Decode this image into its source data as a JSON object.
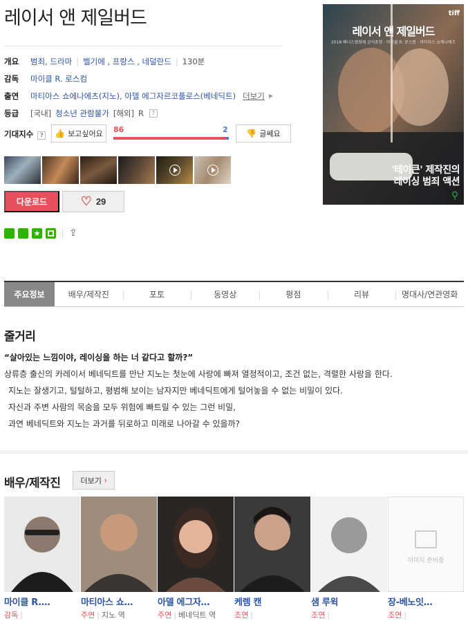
{
  "movie": {
    "title": "레이서 앤 제일버드",
    "info": {
      "overview_label": "개요",
      "genres": "범죄, 드라마",
      "countries": "벨기에 , 프랑스 , 네덜란드",
      "runtime": "130분",
      "director_label": "감독",
      "director": "마이클 R. 로스컴",
      "cast_label": "출연",
      "cast": "마티아스 쇼에나에츠(지노), 아델 에그자르코풀로스(베네딕트)",
      "cast_more": "더보기",
      "rating_label": "등급",
      "rating_domestic_prefix": "[국내]",
      "rating_domestic": "청소년 관람불가",
      "rating_foreign_prefix": "[해외]",
      "rating_foreign": "R",
      "help_glyph": "?"
    },
    "expectation": {
      "label": "기대지수",
      "want_label": "보고싶어요",
      "no_label": "글쎄요",
      "want_count": "86",
      "no_count": "2",
      "want_ratio": 0.977
    },
    "download_label": "다운로드",
    "like_count": "29",
    "poster": {
      "title": "레이서 앤 제일버드",
      "tiff": "tiff",
      "small_text": "2018 베니스영화제 공식초청 · 마이클 R. 로스컴 · 마티아스 쇼에나에츠",
      "tagline_1": "'테이큰' 제작진의",
      "tagline_2": "레이싱 범죄 액션"
    }
  },
  "tabs": [
    "주요정보",
    "배우/제작진",
    "포토",
    "동영상",
    "평점",
    "리뷰",
    "명대사/연관영화"
  ],
  "synopsis": {
    "heading": "줄거리",
    "quote": "“살아있는 느낌이야, 레이싱을 하는 너 같다고 할까?”",
    "lines": [
      "상류층 출신의 카레이서 베네딕트를 만난 지노는 첫눈에 사랑에 빠져 열정적이고, 조건 없는, 격렬한 사랑을 한다.",
      "지노는 잘생기고, 털털하고, 평범해 보이는 남자지만 베네딕트에게 털어놓을 수 없는 비밀이 있다.",
      "자신과 주변 사람의 목숨을 모두 위험에 빠트릴 수 있는 그런 비밀,",
      "과연 베네딕트와 지노는 과거를 뒤로하고 미래로 나아갈 수 있을까?"
    ]
  },
  "cast_section": {
    "heading": "배우/제작진",
    "more_label": "더보기",
    "no_image_text": "이미지 준비중",
    "people": [
      {
        "name": "마이클 R.…",
        "role": "감독",
        "as": ""
      },
      {
        "name": "마티아스 쇼…",
        "role": "주연",
        "as": "지노 역"
      },
      {
        "name": "아델 에그자…",
        "role": "주연",
        "as": "베네딕트 역"
      },
      {
        "name": "케렘 캔",
        "role": "조연",
        "as": ""
      },
      {
        "name": "샘 루윅",
        "role": "조연",
        "as": ""
      },
      {
        "name": "장-베노잇…",
        "role": "조연",
        "as": ""
      }
    ]
  },
  "colors": {
    "accent_red": "#e8505b",
    "link_blue": "#2b53a6",
    "dislike_blue": "#4a7ad0"
  },
  "icons": [
    "blog-icon",
    "cafe-icon",
    "star-icon",
    "square-icon",
    "share-icon",
    "heart-icon",
    "thumbs-up-icon",
    "thumbs-down-icon",
    "play-icon",
    "zoom-icon"
  ]
}
